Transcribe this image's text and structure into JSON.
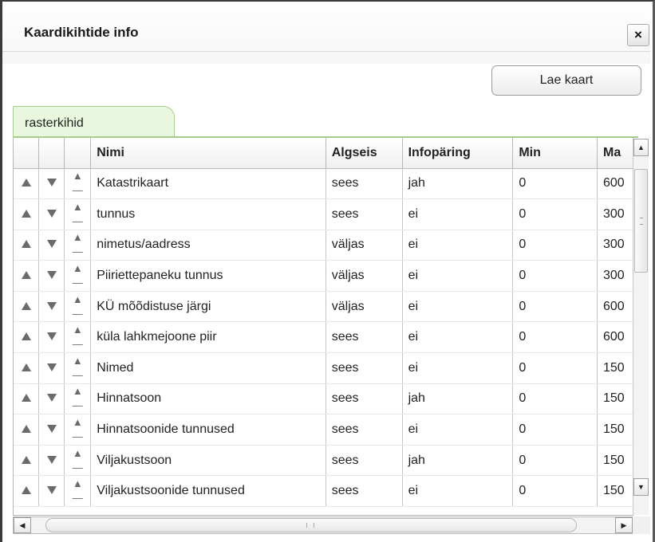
{
  "dialog": {
    "title": "Kaardikihtide info",
    "close_label": "×",
    "load_button_label": "Lae kaart"
  },
  "tabs": [
    {
      "label": "rasterkihid",
      "active": true
    }
  ],
  "table": {
    "columns": [
      "",
      "",
      "",
      "Nimi",
      "Algseis",
      "Infopäring",
      "Min",
      "Ma"
    ],
    "rows": [
      {
        "name": "Katastrikaart",
        "initial": "sees",
        "query": "jah",
        "min": "0",
        "max": "600"
      },
      {
        "name": "tunnus",
        "initial": "sees",
        "query": "ei",
        "min": "0",
        "max": "300"
      },
      {
        "name": "nimetus/aadress",
        "initial": "väljas",
        "query": "ei",
        "min": "0",
        "max": "300"
      },
      {
        "name": "Piiriettepaneku tunnus",
        "initial": "väljas",
        "query": "ei",
        "min": "0",
        "max": "300"
      },
      {
        "name": "KÜ mõõdistuse järgi",
        "initial": "väljas",
        "query": "ei",
        "min": "0",
        "max": "600"
      },
      {
        "name": "küla lahkmejoone piir",
        "initial": "sees",
        "query": "ei",
        "min": "0",
        "max": "600"
      },
      {
        "name": "Nimed",
        "initial": "sees",
        "query": "ei",
        "min": "0",
        "max": "150"
      },
      {
        "name": "Hinnatsoon",
        "initial": "sees",
        "query": "jah",
        "min": "0",
        "max": "150"
      },
      {
        "name": "Hinnatsoonide tunnused",
        "initial": "sees",
        "query": "ei",
        "min": "0",
        "max": "150"
      },
      {
        "name": "Viljakustsoon",
        "initial": "sees",
        "query": "jah",
        "min": "0",
        "max": "150"
      },
      {
        "name": "Viljakustsoonide tunnused",
        "initial": "sees",
        "query": "ei",
        "min": "0",
        "max": "150"
      }
    ]
  },
  "icons": {
    "move_up": "triangle-up-icon",
    "move_down": "triangle-down-icon",
    "move_top": "move-to-top-icon"
  },
  "colors": {
    "tab_background": "#eaf7df",
    "tab_border": "#a7cc8c"
  }
}
